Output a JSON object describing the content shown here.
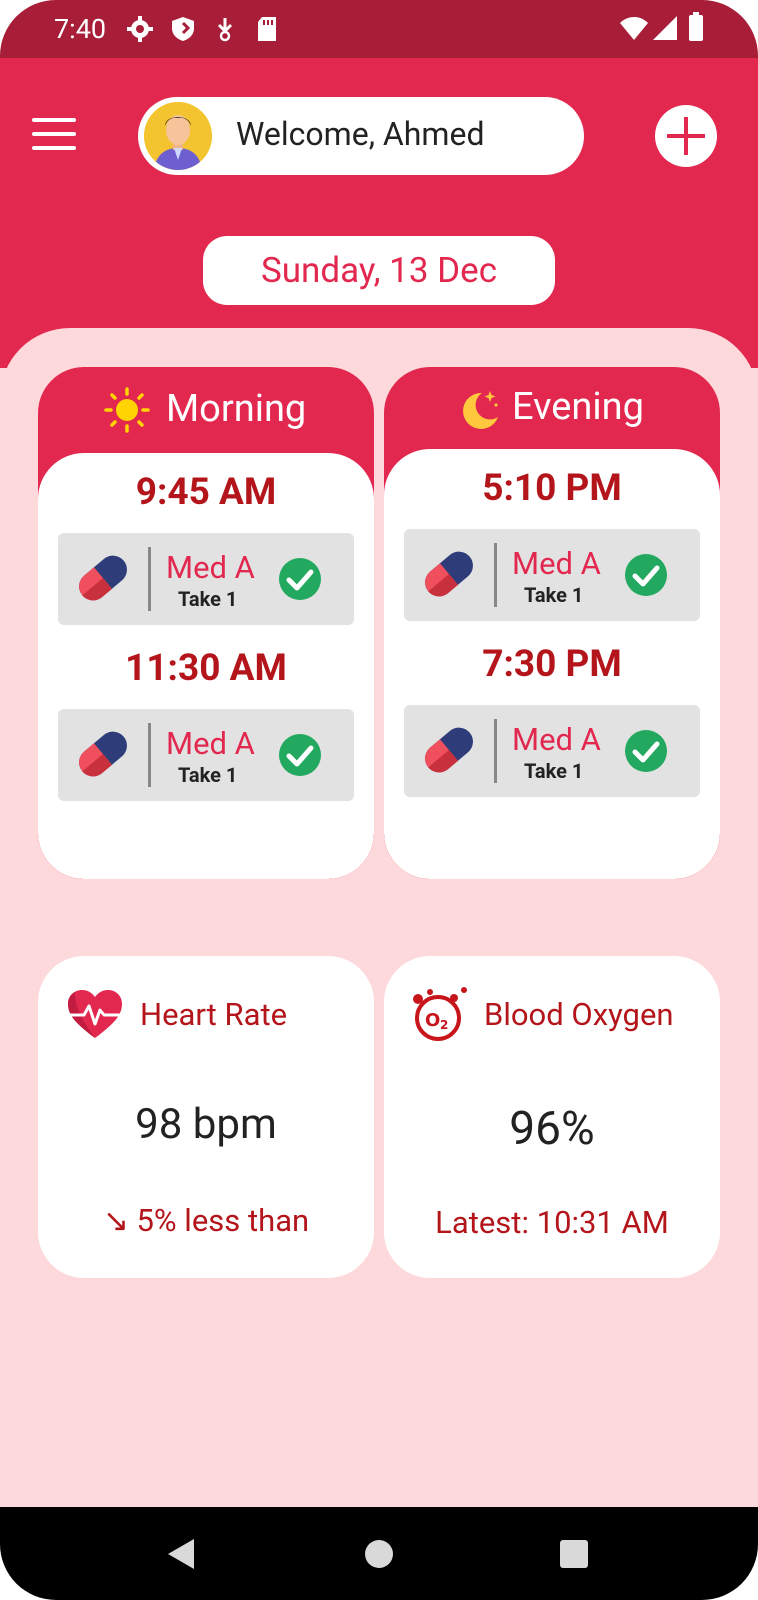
{
  "status_bar": {
    "time": "7:40",
    "icons": [
      "settings-icon",
      "shield-icon",
      "download-icon",
      "sd-card-icon",
      "wifi-icon",
      "cell-signal-icon",
      "battery-icon"
    ]
  },
  "header": {
    "welcome_text": "Welcome, Ahmed",
    "date": "Sunday, 13 Dec",
    "colors": {
      "primary": "#e2284f",
      "dark": "#a81d38",
      "background": "#fdd9dc",
      "accent_text": "#b3151b"
    }
  },
  "schedule": {
    "morning": {
      "title": "Morning",
      "icon": "sun-icon",
      "entries": [
        {
          "time": "9:45 AM",
          "med": "Med A",
          "dose": "Take 1",
          "taken": true
        },
        {
          "time": "11:30 AM",
          "med": "Med A",
          "dose": "Take 1",
          "taken": true
        }
      ]
    },
    "evening": {
      "title": "Evening",
      "icon": "moon-icon",
      "entries": [
        {
          "time": "5:10 PM",
          "med": "Med A",
          "dose": "Take 1",
          "taken": true
        },
        {
          "time": "7:30 PM",
          "med": "Med A",
          "dose": "Take 1",
          "taken": true
        }
      ]
    }
  },
  "vitals": {
    "heart_rate": {
      "title": "Heart Rate",
      "value": "98 bpm",
      "trend": "↘ 5% less than",
      "icon": "heart-rate-icon"
    },
    "blood_oxygen": {
      "title": "Blood Oxygen",
      "value": "96%",
      "latest": "Latest:  10:31 AM",
      "icon": "oxygen-icon"
    }
  },
  "nav": {
    "buttons": [
      "back-icon",
      "home-icon",
      "recents-icon"
    ]
  }
}
